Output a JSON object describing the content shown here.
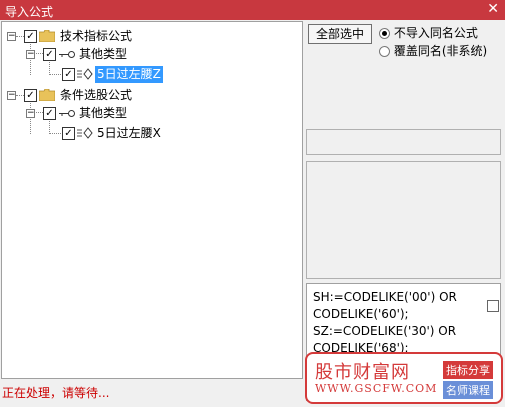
{
  "window": {
    "title": "导入公式",
    "close": "✕"
  },
  "tree": {
    "g1": {
      "label": "技术指标公式",
      "expander": "−",
      "check": "✓"
    },
    "g1c": {
      "label": "其他类型",
      "expander": "−",
      "check": "✓"
    },
    "g1f": {
      "label": "5日过左腰Z",
      "check": "✓"
    },
    "g2": {
      "label": "条件选股公式",
      "expander": "−",
      "check": "✓"
    },
    "g2c": {
      "label": "其他类型",
      "expander": "−",
      "check": "✓"
    },
    "g2f": {
      "label": "5日过左腰X",
      "check": "✓"
    }
  },
  "right": {
    "select_all": "全部选中",
    "radio1": "不导入同名公式",
    "radio2": "覆盖同名(非系统)"
  },
  "code": {
    "lines": [
      "SH:=CODELIKE('00') OR",
      "CODELIKE('60');",
      "SZ:=CODELIKE('30') OR",
      "CODELIKE('68');"
    ]
  },
  "watermark": {
    "name": "股市财富网",
    "url": "WWW.GSCFW.COM",
    "tag1": "指标分享",
    "tag2": "名师课程"
  },
  "status": "正在处理，请等待..."
}
